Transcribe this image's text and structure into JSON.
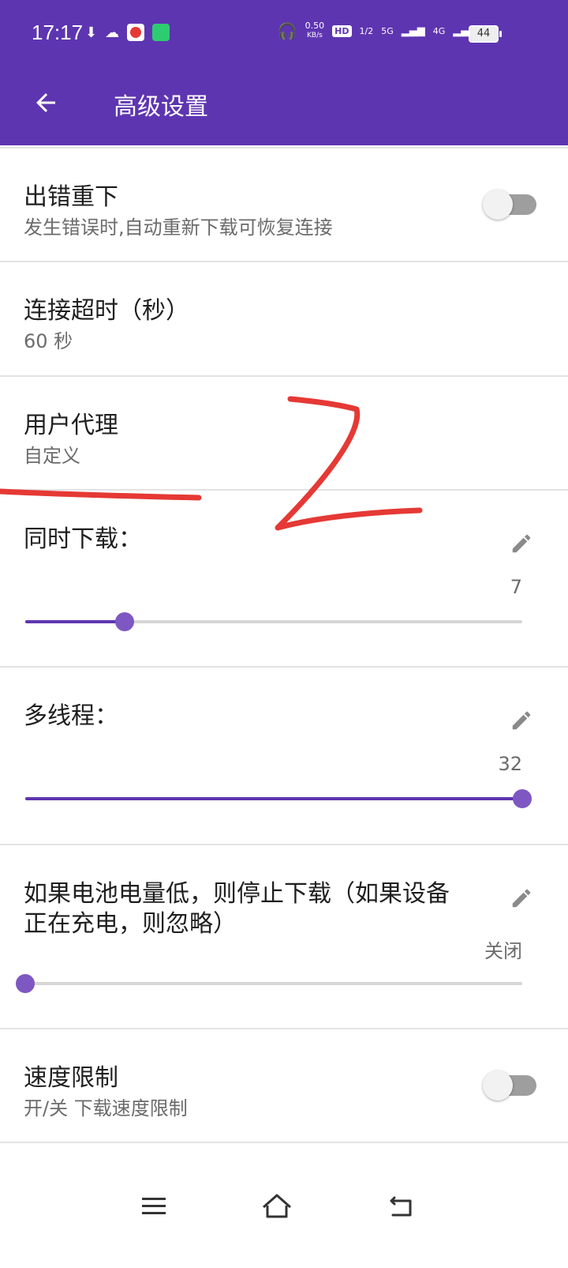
{
  "status_bar": {
    "time": "17:17",
    "net_speed_value": "0.50",
    "net_speed_unit": "KB/s",
    "hd_badge": "HD",
    "sim": "1/2",
    "signal_5g": "5G",
    "signal_4g": "4G",
    "battery": "44"
  },
  "app_bar": {
    "title": "高级设置",
    "back_icon": "arrow-left-icon"
  },
  "settings": {
    "retry": {
      "label": "出错重下",
      "summary": "发生错误时,自动重新下载可恢复连接",
      "enabled": false
    },
    "timeout": {
      "label": "连接超时（秒）",
      "summary": "60 秒"
    },
    "user_agent": {
      "label": "用户代理",
      "summary": "自定义"
    },
    "concurrent": {
      "label": "同时下载：",
      "value": "7",
      "fill_percent": 20
    },
    "threads": {
      "label": "多线程：",
      "value": "32",
      "fill_percent": 100
    },
    "battery_low": {
      "label_line1": "如果电池电量低，则停止下载（如果设备",
      "label_line2": "正在充电，则忽略）",
      "value": "关闭",
      "fill_percent": 0
    },
    "speed_limit": {
      "label": "速度限制",
      "summary": "开/关 下载速度限制",
      "enabled": false
    }
  },
  "colors": {
    "primary": "#5e35b1",
    "accent": "#7e57c2",
    "annotation": "#e53935"
  },
  "nav_bar": {
    "menu_icon": "menu-icon",
    "home_icon": "home-icon",
    "back_icon": "back-nav-icon"
  }
}
